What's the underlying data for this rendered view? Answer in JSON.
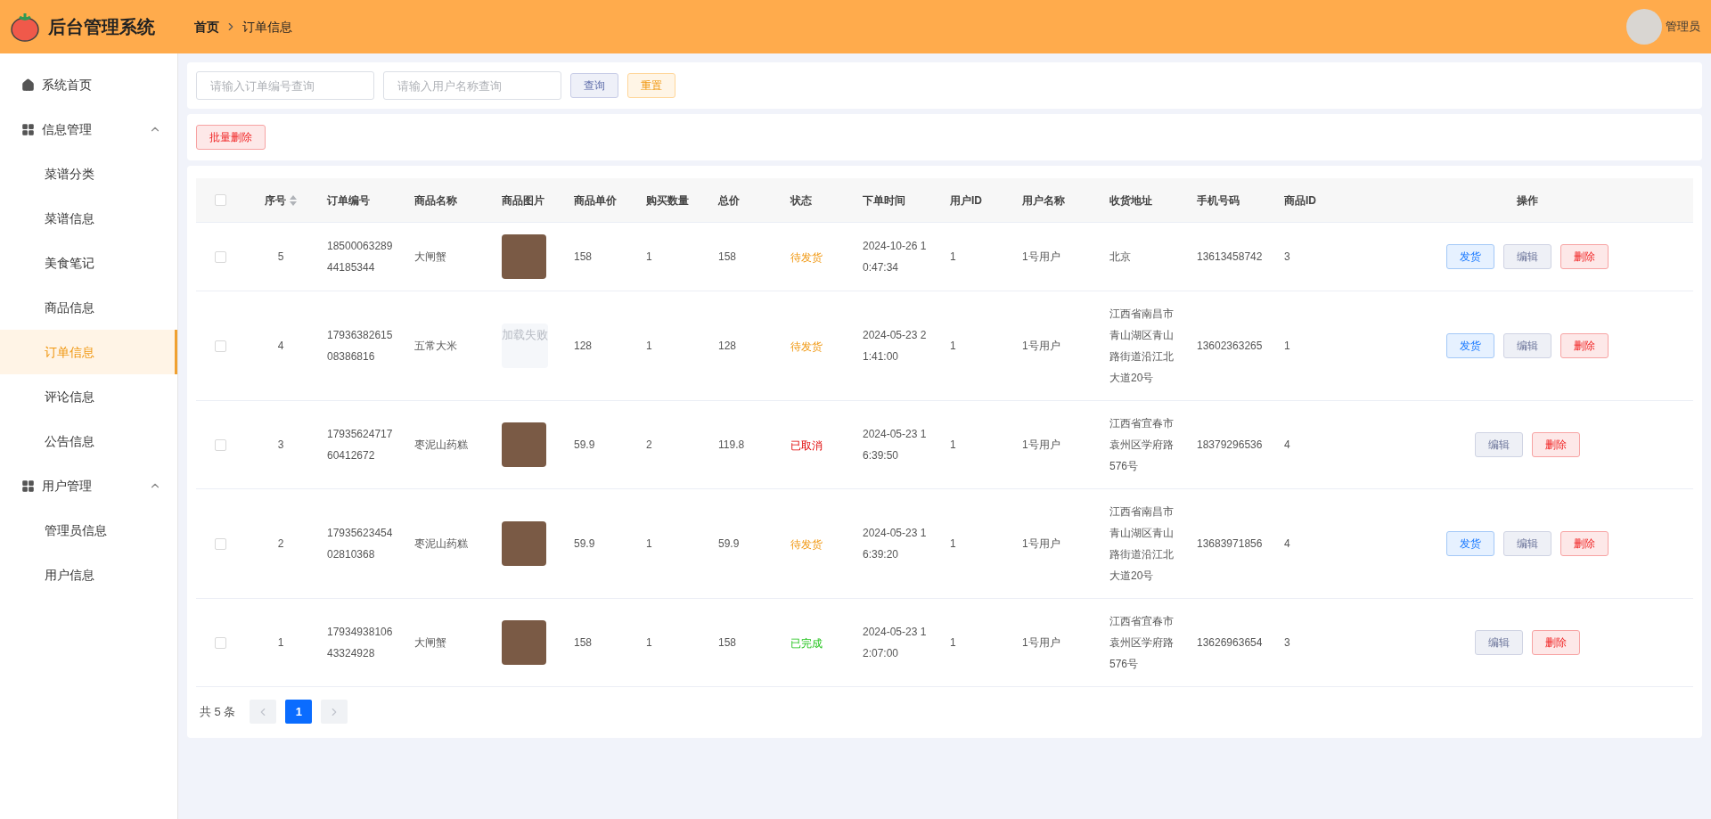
{
  "header": {
    "title": "后台管理系统",
    "breadcrumb": [
      "首页",
      "订单信息"
    ],
    "user": {
      "name": "管理员"
    }
  },
  "sidebar": {
    "items": [
      {
        "label": "系统首页",
        "kind": "link",
        "selected": false
      },
      {
        "label": "信息管理",
        "kind": "group",
        "expanded": true,
        "children": [
          {
            "label": "菜谱分类",
            "selected": false
          },
          {
            "label": "菜谱信息",
            "selected": false
          },
          {
            "label": "美食笔记",
            "selected": false
          },
          {
            "label": "商品信息",
            "selected": false
          },
          {
            "label": "订单信息",
            "selected": true
          },
          {
            "label": "评论信息",
            "selected": false
          },
          {
            "label": "公告信息",
            "selected": false
          }
        ]
      },
      {
        "label": "用户管理",
        "kind": "group",
        "expanded": true,
        "children": [
          {
            "label": "管理员信息",
            "selected": false
          },
          {
            "label": "用户信息",
            "selected": false
          }
        ]
      }
    ]
  },
  "search": {
    "fields": [
      {
        "placeholder": "请输入订单编号查询"
      },
      {
        "placeholder": "请输入用户名称查询"
      }
    ],
    "buttons": [
      {
        "label": "查询",
        "kind": "query"
      },
      {
        "label": "重置",
        "kind": "reset"
      }
    ]
  },
  "toolbar": {
    "buttons": [
      {
        "label": "批量删除",
        "kind": "delete"
      }
    ]
  },
  "table": {
    "select_all": {
      "checked": false
    },
    "columns": [
      "序号",
      "订单编号",
      "商品名称",
      "商品图片",
      "商品单价",
      "购买数量",
      "总价",
      "状态",
      "下单时间",
      "用户ID",
      "用户名称",
      "收货地址",
      "手机号码",
      "商品ID",
      "操作"
    ],
    "rows": [
      {
        "checked": false,
        "index": "5",
        "order_no": "1850006328944185344",
        "product": "大闸蟹",
        "image": {
          "kind": "photo"
        },
        "price": "158",
        "quantity": "1",
        "total": "158",
        "status": {
          "label": "待发货",
          "kind": "pending"
        },
        "time": "2024-10-26 10:47:34",
        "user_id": "1",
        "user_name": "1号用户",
        "address": "北京",
        "phone": "13613458742",
        "product_id": "3",
        "actions": [
          {
            "label": "发货",
            "kind": "ship"
          },
          {
            "label": "编辑",
            "kind": "edit"
          },
          {
            "label": "删除",
            "kind": "delete"
          }
        ]
      },
      {
        "checked": false,
        "index": "4",
        "order_no": "1793638261508386816",
        "product": "五常大米",
        "image": {
          "kind": "failed",
          "text": "加载失败"
        },
        "price": "128",
        "quantity": "1",
        "total": "128",
        "status": {
          "label": "待发货",
          "kind": "pending"
        },
        "time": "2024-05-23 21:41:00",
        "user_id": "1",
        "user_name": "1号用户",
        "address": "江西省南昌市青山湖区青山路街道沿江北大道20号",
        "phone": "13602363265",
        "product_id": "1",
        "actions": [
          {
            "label": "发货",
            "kind": "ship"
          },
          {
            "label": "编辑",
            "kind": "edit"
          },
          {
            "label": "删除",
            "kind": "delete"
          }
        ]
      },
      {
        "checked": false,
        "index": "3",
        "order_no": "1793562471760412672",
        "product": "枣泥山药糕",
        "image": {
          "kind": "photo"
        },
        "price": "59.9",
        "quantity": "2",
        "total": "119.8",
        "status": {
          "label": "已取消",
          "kind": "cancelled"
        },
        "time": "2024-05-23 16:39:50",
        "user_id": "1",
        "user_name": "1号用户",
        "address": "江西省宜春市袁州区学府路576号",
        "phone": "18379296536",
        "product_id": "4",
        "actions": [
          {
            "label": "编辑",
            "kind": "edit"
          },
          {
            "label": "删除",
            "kind": "delete"
          }
        ]
      },
      {
        "checked": false,
        "index": "2",
        "order_no": "1793562345402810368",
        "product": "枣泥山药糕",
        "image": {
          "kind": "photo"
        },
        "price": "59.9",
        "quantity": "1",
        "total": "59.9",
        "status": {
          "label": "待发货",
          "kind": "pending"
        },
        "time": "2024-05-23 16:39:20",
        "user_id": "1",
        "user_name": "1号用户",
        "address": "江西省南昌市青山湖区青山路街道沿江北大道20号",
        "phone": "13683971856",
        "product_id": "4",
        "actions": [
          {
            "label": "发货",
            "kind": "ship"
          },
          {
            "label": "编辑",
            "kind": "edit"
          },
          {
            "label": "删除",
            "kind": "delete"
          }
        ]
      },
      {
        "checked": false,
        "index": "1",
        "order_no": "1793493810643324928",
        "product": "大闸蟹",
        "image": {
          "kind": "photo"
        },
        "price": "158",
        "quantity": "1",
        "total": "158",
        "status": {
          "label": "已完成",
          "kind": "done"
        },
        "time": "2024-05-23 12:07:00",
        "user_id": "1",
        "user_name": "1号用户",
        "address": "江西省宜春市袁州区学府路576号",
        "phone": "13626963654",
        "product_id": "3",
        "actions": [
          {
            "label": "编辑",
            "kind": "edit"
          },
          {
            "label": "删除",
            "kind": "delete"
          }
        ]
      }
    ]
  },
  "pagination": {
    "total": "共 5 条",
    "pages": [
      {
        "label": "1",
        "selected": true
      }
    ]
  }
}
